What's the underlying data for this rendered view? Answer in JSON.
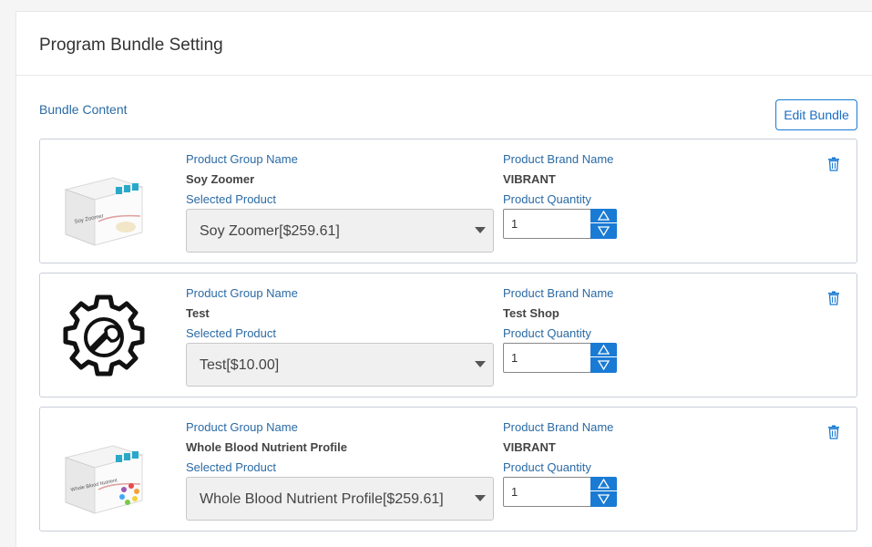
{
  "page": {
    "title": "Program Bundle Setting"
  },
  "bundle": {
    "section_label": "Bundle Content",
    "edit_button": "Edit Bundle",
    "labels": {
      "group": "Product Group Name",
      "brand": "Product Brand Name",
      "selected": "Selected Product",
      "quantity": "Product Quantity"
    },
    "items": [
      {
        "group_name": "Soy Zoomer",
        "brand_name": "VIBRANT",
        "selected_product": "Soy Zoomer[$259.61]",
        "quantity": "1",
        "image": "product-box-soy-zoomer",
        "image_text": "Soy Zoomer"
      },
      {
        "group_name": "Test",
        "brand_name": "Test Shop",
        "selected_product": "Test[$10.00]",
        "quantity": "1",
        "image": "gear-wrench-icon"
      },
      {
        "group_name": "Whole Blood Nutrient Profile",
        "brand_name": "VIBRANT",
        "selected_product": "Whole Blood Nutrient Profile[$259.61]",
        "quantity": "1",
        "image": "product-box-whole-blood",
        "image_text": "Whole Blood Nutrient"
      }
    ]
  },
  "colors": {
    "accent": "#1a7bd4",
    "label": "#2a6aa5",
    "border": "#c9d0d9"
  }
}
